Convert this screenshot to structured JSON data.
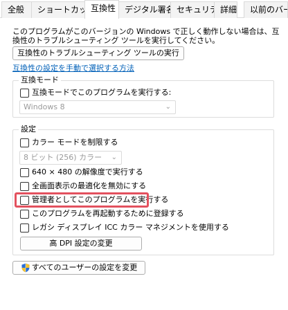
{
  "tabs": [
    {
      "label": "全般",
      "active": false
    },
    {
      "label": "ショートカット",
      "active": false
    },
    {
      "label": "互換性",
      "active": true
    },
    {
      "label": "デジタル署名",
      "active": false
    },
    {
      "label": "セキュリティ",
      "active": false
    },
    {
      "label": "詳細",
      "active": false
    },
    {
      "label": "以前のバー",
      "active": false
    }
  ],
  "description": "このプログラムがこのバージョンの Windows で正しく動作しない場合は、互換性のトラブルシューティング ツールを実行してください。",
  "troubleshoot_button": "互換性のトラブルシューティング ツールの実行",
  "manual_link": "互換性の設定を手動で選択する方法",
  "compat_mode": {
    "title": "互換モード",
    "checkbox_label": "互換モードでこのプログラムを実行する:",
    "checked": false,
    "combo_value": "Windows 8"
  },
  "settings": {
    "title": "設定",
    "reduced_color": {
      "label": "カラー モードを制限する",
      "checked": false
    },
    "color_combo": "8 ビット (256) カラー",
    "res_640": {
      "label": "640 × 480 の解像度で実行する",
      "checked": false
    },
    "fullscreen_opt": {
      "label": "全画面表示の最適化を無効にする",
      "checked": false
    },
    "run_as_admin": {
      "label": "管理者としてこのプログラムを実行する",
      "checked": false
    },
    "register_restart": {
      "label": "このプログラムを再起動するために登録する",
      "checked": false
    },
    "legacy_icc": {
      "label": "レガシ ディスプレイ ICC カラー マネジメントを使用する",
      "checked": false
    },
    "high_dpi_button": "高 DPI 設定の変更"
  },
  "all_users_button": "すべてのユーザーの設定を変更",
  "colors": {
    "highlight": "#e3515e",
    "link": "#0060b8"
  }
}
